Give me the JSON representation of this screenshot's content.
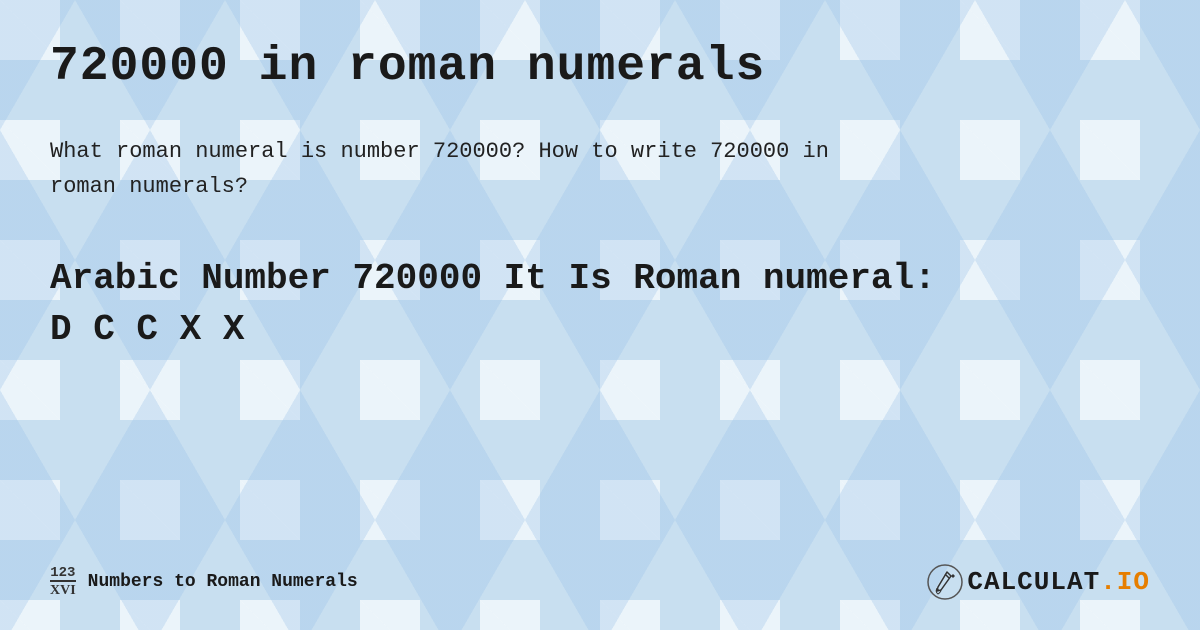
{
  "page": {
    "title": "720000 in roman numerals",
    "description_part1": "What roman numeral is number 720000? How to write 720000 in",
    "description_part2": "roman numerals?",
    "result_line1": "Arabic Number 720000 It Is  Roman numeral:",
    "result_line2": "D C C X X",
    "footer": {
      "logo_top": "123",
      "logo_bottom": "XVI",
      "brand_text": "Numbers to Roman Numerals",
      "calc_brand": "CALCULAT",
      "calc_io": ".IO"
    }
  }
}
